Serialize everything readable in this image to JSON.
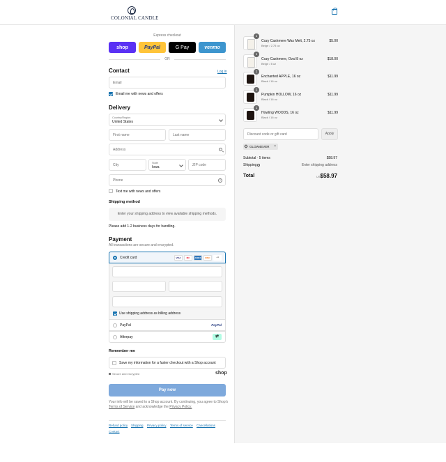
{
  "brand": {
    "name": "COLONIAL CANDLE"
  },
  "header": {
    "cart_icon": "shopping-bag-icon"
  },
  "express": {
    "title": "Express checkout",
    "buttons": [
      "shop",
      "PayPal",
      "G Pay",
      "venmo"
    ],
    "or_label": "OR"
  },
  "contact": {
    "title": "Contact",
    "login_link": "Log in",
    "email_placeholder": "Email",
    "news_label": "Email me with news and offers",
    "news_checked": true
  },
  "delivery": {
    "title": "Delivery",
    "country_label": "Country/Region",
    "country_value": "United States",
    "first_name_placeholder": "First name",
    "last_name_placeholder": "Last name",
    "address_placeholder": "Address",
    "city_placeholder": "City",
    "state_label": "State",
    "state_value": "Iowa",
    "zip_placeholder": "ZIP code",
    "phone_placeholder": "Phone",
    "text_label": "Text me with news and offers",
    "text_checked": false
  },
  "shipping": {
    "title": "Shipping method",
    "notice": "Enter your shipping address to view available shipping methods.",
    "handling_note": "Please add 1-2 business days for handling."
  },
  "payment": {
    "title": "Payment",
    "subtitle": "All transactions are secure and encrypted.",
    "credit_card_label": "Credit card",
    "card_logos": [
      "VISA",
      "MC",
      "AMEX",
      "DISC",
      "+4"
    ],
    "billing_label": "Use shipping address as billing address",
    "billing_checked": true,
    "paypal_label": "PayPal",
    "paypal_logo": "PayPal",
    "afterpay_label": "Afterpay"
  },
  "remember": {
    "title": "Remember me",
    "save_label": "Save my information for a faster checkout with a Shop account",
    "secure_label": "Secure and encrypted",
    "shop_logo": "shop"
  },
  "pay_button": "Pay now",
  "consent": {
    "line1": "Your info will be saved to a Shop account. By continuing, you agree to Shop's",
    "terms_link": "Terms of Service",
    "and_text": "and acknowledge the",
    "privacy_link": "Privacy Policy."
  },
  "footer_links": [
    "Refund policy",
    "Shipping",
    "Privacy policy",
    "Terms of service",
    "Cancellations",
    "Contact"
  ],
  "order": {
    "items": [
      {
        "qty": "1",
        "name": "Cozy Cashmere Wax Melt, 2.75 oz",
        "variant": "Beige / 2.75 oz",
        "price": "$5.00",
        "thumb": "light"
      },
      {
        "qty": "1",
        "name": "Cozy Cashmere, Oval 8 oz",
        "variant": "Beige / 8 oz",
        "price": "$18.00",
        "thumb": "light"
      },
      {
        "qty": "1",
        "name": "Enchanted APPLE, 16 oz",
        "variant": "Black / 16 oz",
        "price": "$11.99",
        "thumb": "dark"
      },
      {
        "qty": "1",
        "name": "Pumpkin HOLLOW, 16 oz",
        "variant": "Black / 16 oz",
        "price": "$11.99",
        "thumb": "dark"
      },
      {
        "qty": "1",
        "name": "Howling WOODS, 16 oz",
        "variant": "Black / 16 oz",
        "price": "$11.99",
        "thumb": "dark"
      }
    ],
    "discount_placeholder": "Discount code or gift card",
    "apply_label": "Apply",
    "applied_code": "GLOW4EVER",
    "subtotal_label": "Subtotal · 5 items",
    "subtotal_value": "$58.97",
    "shipping_label": "Shipping",
    "shipping_value": "Enter shipping address",
    "total_label": "Total",
    "currency": "USD",
    "total_value": "$58.97"
  }
}
